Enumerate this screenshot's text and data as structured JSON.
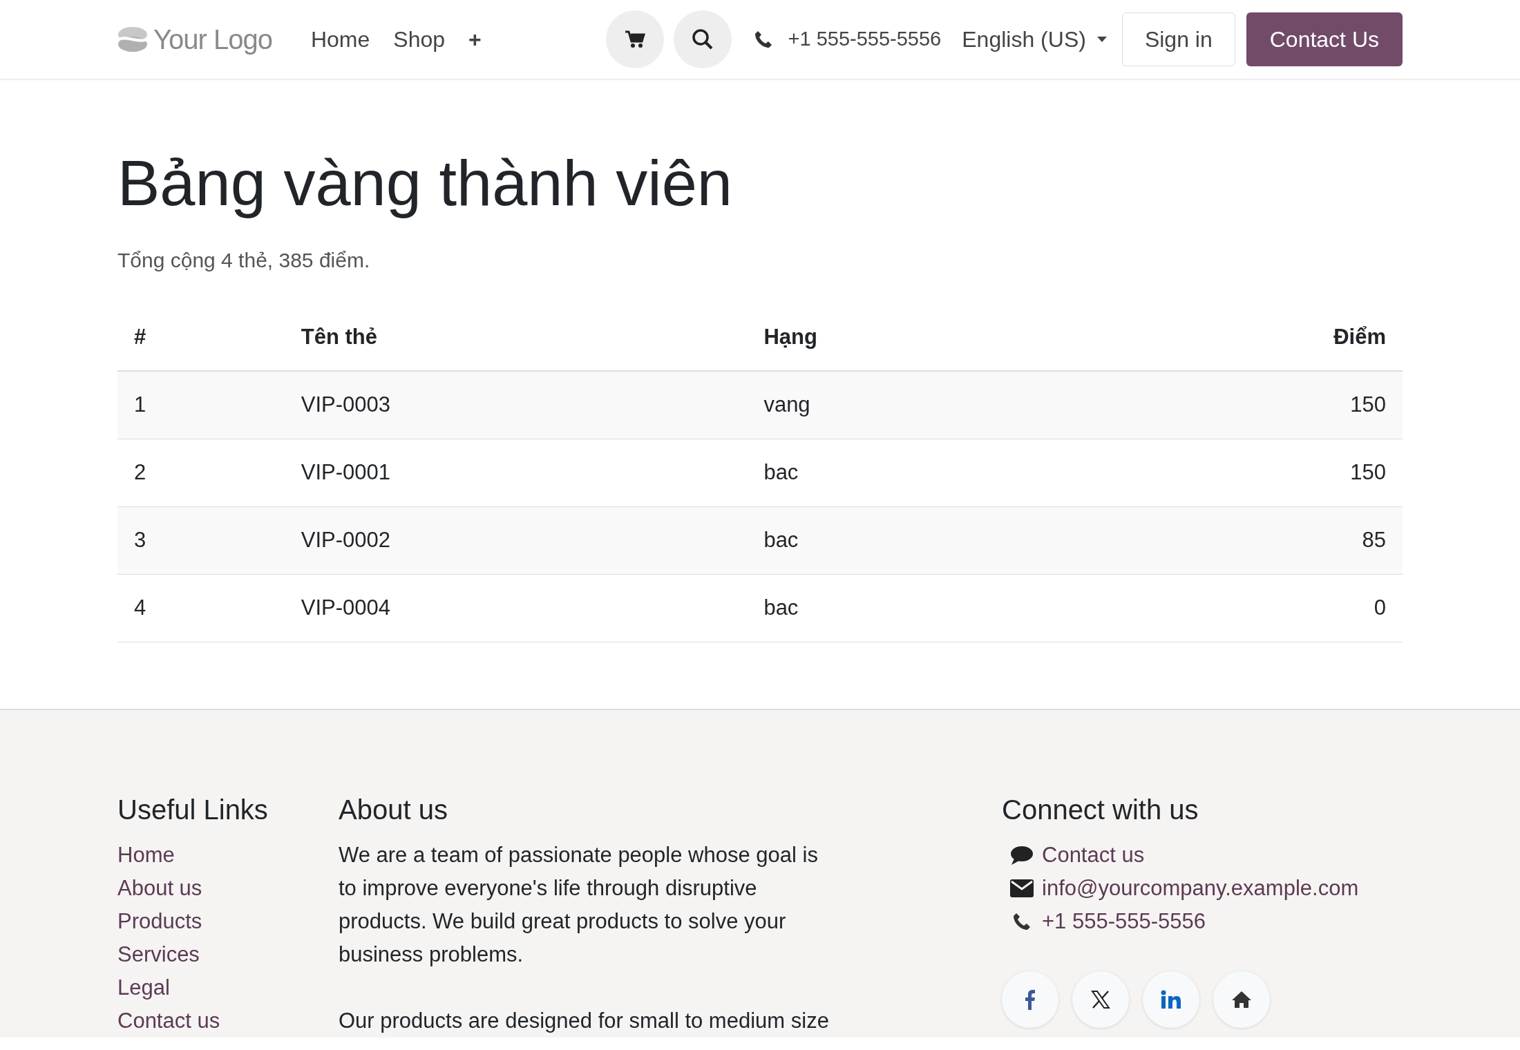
{
  "header": {
    "logo": "Your Logo",
    "nav": [
      {
        "label": "Home"
      },
      {
        "label": "Shop"
      },
      {
        "label": "+"
      }
    ],
    "phone": "+1 555-555-5556",
    "language": "English (US)",
    "sign_in": "Sign in",
    "contact_button": "Contact Us"
  },
  "main": {
    "title": "Bảng vàng thành viên",
    "summary": "Tổng cộng 4 thẻ, 385 điểm.",
    "table": {
      "columns": [
        "#",
        "Tên thẻ",
        "Hạng",
        "Điểm"
      ],
      "rows": [
        [
          "1",
          "VIP-0003",
          "vang",
          "150"
        ],
        [
          "2",
          "VIP-0001",
          "bac",
          "150"
        ],
        [
          "3",
          "VIP-0002",
          "bac",
          "85"
        ],
        [
          "4",
          "VIP-0004",
          "bac",
          "0"
        ]
      ]
    }
  },
  "footer": {
    "useful_links": {
      "title": "Useful Links",
      "links": [
        "Home",
        "About us",
        "Products",
        "Services",
        "Legal",
        "Contact us"
      ]
    },
    "about": {
      "title": "About us",
      "paragraphs": [
        "We are a team of passionate people whose goal is to improve everyone's life through disruptive products. We build great products to solve your business problems.",
        "Our products are designed for small to medium size"
      ]
    },
    "connect": {
      "title": "Connect with us",
      "items": [
        {
          "kind": "chat",
          "text": "Contact us"
        },
        {
          "kind": "mail",
          "text": "info@yourcompany.example.com"
        },
        {
          "kind": "phone",
          "text": "+1 555-555-5556"
        }
      ],
      "social": [
        {
          "kind": "facebook"
        },
        {
          "kind": "x"
        },
        {
          "kind": "linkedin"
        },
        {
          "kind": "home"
        }
      ]
    }
  }
}
